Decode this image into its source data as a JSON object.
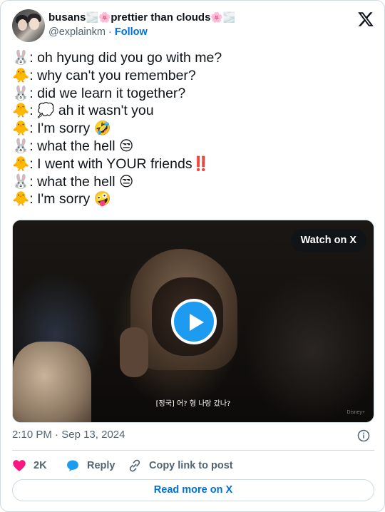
{
  "author": {
    "display_name": "busans",
    "name_emojis": [
      "🌫️",
      "🌸",
      "🌸",
      "🌫️"
    ],
    "name_text": "prettier than clouds",
    "handle": "@explainkm",
    "separator": "·",
    "follow_label": "Follow"
  },
  "tweet": {
    "lines": [
      {
        "speaker": "🐰",
        "text": ": oh hyung did you go with me?"
      },
      {
        "speaker": "🐥",
        "text": ": why can't you remember?"
      },
      {
        "speaker": "🐰",
        "text": ": did we learn it together?"
      },
      {
        "speaker": "🐥",
        "text": ": 💭 ah it wasn't you"
      },
      {
        "speaker": "🐥",
        "text": ": I'm sorry 🤣"
      },
      {
        "speaker": "🐰",
        "text": ": what the hell 😒"
      },
      {
        "speaker": "🐥",
        "text": ": I went with YOUR friends‼️"
      },
      {
        "speaker": "🐰",
        "text": ": what the hell 😒"
      },
      {
        "speaker": "🐥",
        "text": ": I'm sorry 🤪"
      }
    ]
  },
  "media": {
    "watch_label": "Watch on X",
    "subtitle": "[정국] 어? 형 나랑 갔나?",
    "watermark": "Disney+",
    "play_icon": "play-icon"
  },
  "meta": {
    "time": "2:10 PM",
    "separator": "·",
    "date": "Sep 13, 2024"
  },
  "actions": {
    "like_count": "2K",
    "reply_label": "Reply",
    "copy_label": "Copy link to post"
  },
  "footer": {
    "read_more_label": "Read more on X"
  },
  "colors": {
    "accent": "#1d9bf0",
    "link": "#006fd6",
    "like": "#f91880",
    "muted": "#536471",
    "border": "#cfd9de"
  }
}
